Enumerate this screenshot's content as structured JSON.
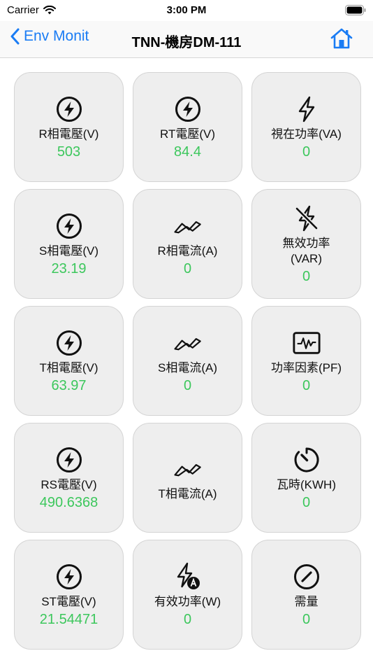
{
  "status": {
    "carrier": "Carrier",
    "time": "3:00 PM"
  },
  "nav": {
    "back_label": "Env Monit",
    "title": "TNN-機房DM-111"
  },
  "tiles": [
    {
      "label": "R相電壓(V)",
      "value": "503",
      "icon": "bolt-circle-icon"
    },
    {
      "label": "RT電壓(V)",
      "value": "84.4",
      "icon": "bolt-circle-icon"
    },
    {
      "label": "視在功率(VA)",
      "value": "0",
      "icon": "bolt-icon"
    },
    {
      "label": "S相電壓(V)",
      "value": "23.19",
      "icon": "bolt-circle-icon"
    },
    {
      "label": "R相電流(A)",
      "value": "0",
      "icon": "wave-icon"
    },
    {
      "label": "無效功率\n(VAR)",
      "value": "0",
      "icon": "bolt-slash-icon"
    },
    {
      "label": "T相電壓(V)",
      "value": "63.97",
      "icon": "bolt-circle-icon"
    },
    {
      "label": "S相電流(A)",
      "value": "0",
      "icon": "wave-icon"
    },
    {
      "label": "功率因素(PF)",
      "value": "0",
      "icon": "waveform-monitor-icon"
    },
    {
      "label": "RS電壓(V)",
      "value": "490.6368",
      "icon": "bolt-circle-icon"
    },
    {
      "label": "T相電流(A)",
      "value": "",
      "icon": "wave-icon"
    },
    {
      "label": "瓦時(KWH)",
      "value": "0",
      "icon": "timer-icon"
    },
    {
      "label": "ST電壓(V)",
      "value": "21.54471",
      "icon": "bolt-circle-icon"
    },
    {
      "label": "有效功率(W)",
      "value": "0",
      "icon": "bolt-a-icon"
    },
    {
      "label": "需量",
      "value": "0",
      "icon": "gauge-icon"
    }
  ],
  "colors": {
    "accent": "#1a7cf4",
    "value": "#3cc75c",
    "tile_bg": "#eeeeee"
  }
}
